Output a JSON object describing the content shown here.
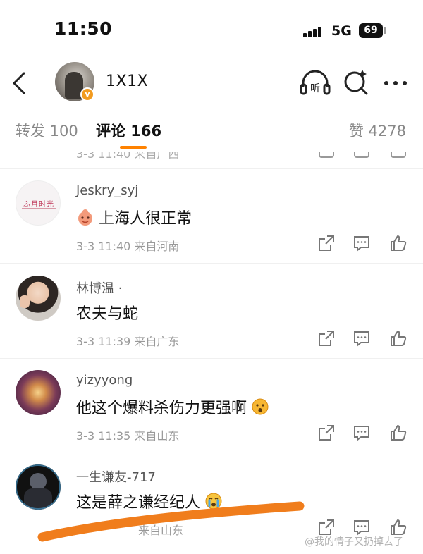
{
  "status_bar": {
    "time": "11:50",
    "network": "5G",
    "battery": "69"
  },
  "header": {
    "account_name": "1X1X",
    "listen_label": "听"
  },
  "tabs": [
    {
      "label": "转发 100"
    },
    {
      "label": "评论 166"
    },
    {
      "label": "赞 4278"
    }
  ],
  "partial_row": {
    "meta": "3-3 11:40 来自广西"
  },
  "comments": [
    {
      "user": "Jeskry_syj",
      "avatar_text": "ふ月时光",
      "text": "上海人很正常",
      "meta": "3-3 11:40 来自河南"
    },
    {
      "user": "林博温 ·",
      "text": "农夫与蛇",
      "meta": "3-3 11:39 来自广东"
    },
    {
      "user": "yizyyong",
      "text": "他这个爆料杀伤力更强啊",
      "meta": "3-3 11:35 来自山东"
    },
    {
      "user": "一生谦友-717",
      "text": "这是薛之谦经纪人",
      "meta": "来自山东"
    }
  ],
  "watermark": "@我的情子又扔掉去了",
  "colors": {
    "accent": "#ff8200",
    "brush": "#f07d1c",
    "verify": "#f29b1f"
  }
}
